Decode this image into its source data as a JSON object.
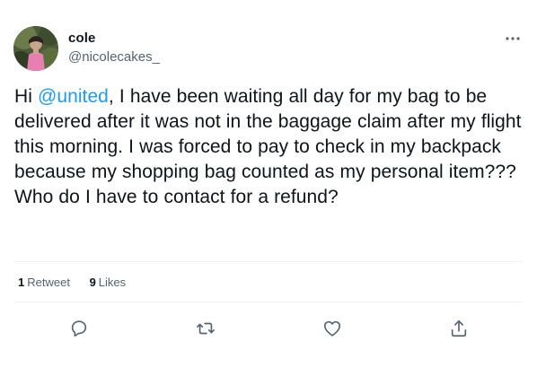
{
  "user": {
    "display_name": "cole",
    "handle": "@nicolecakes_"
  },
  "tweet": {
    "text_before_mention": "Hi ",
    "mention": "@united",
    "text_after_mention": ", I have been waiting all day for my bag to be delivered after it was not in the baggage claim after my flight this morning. I was forced to pay to check in my backpack because my shopping bag counted as my personal item??? Who do I have to contact for a refund?"
  },
  "stats": {
    "retweets_count": "1",
    "retweets_label": "Retweet",
    "likes_count": "9",
    "likes_label": "Likes"
  },
  "icons": {
    "more": "more-icon",
    "reply": "reply-icon",
    "retweet": "retweet-icon",
    "like": "heart-icon",
    "share": "share-icon"
  },
  "colors": {
    "mention": "#1d9bf0",
    "text": "#0f1419",
    "secondary": "#536471",
    "divider": "#eff3f4"
  }
}
